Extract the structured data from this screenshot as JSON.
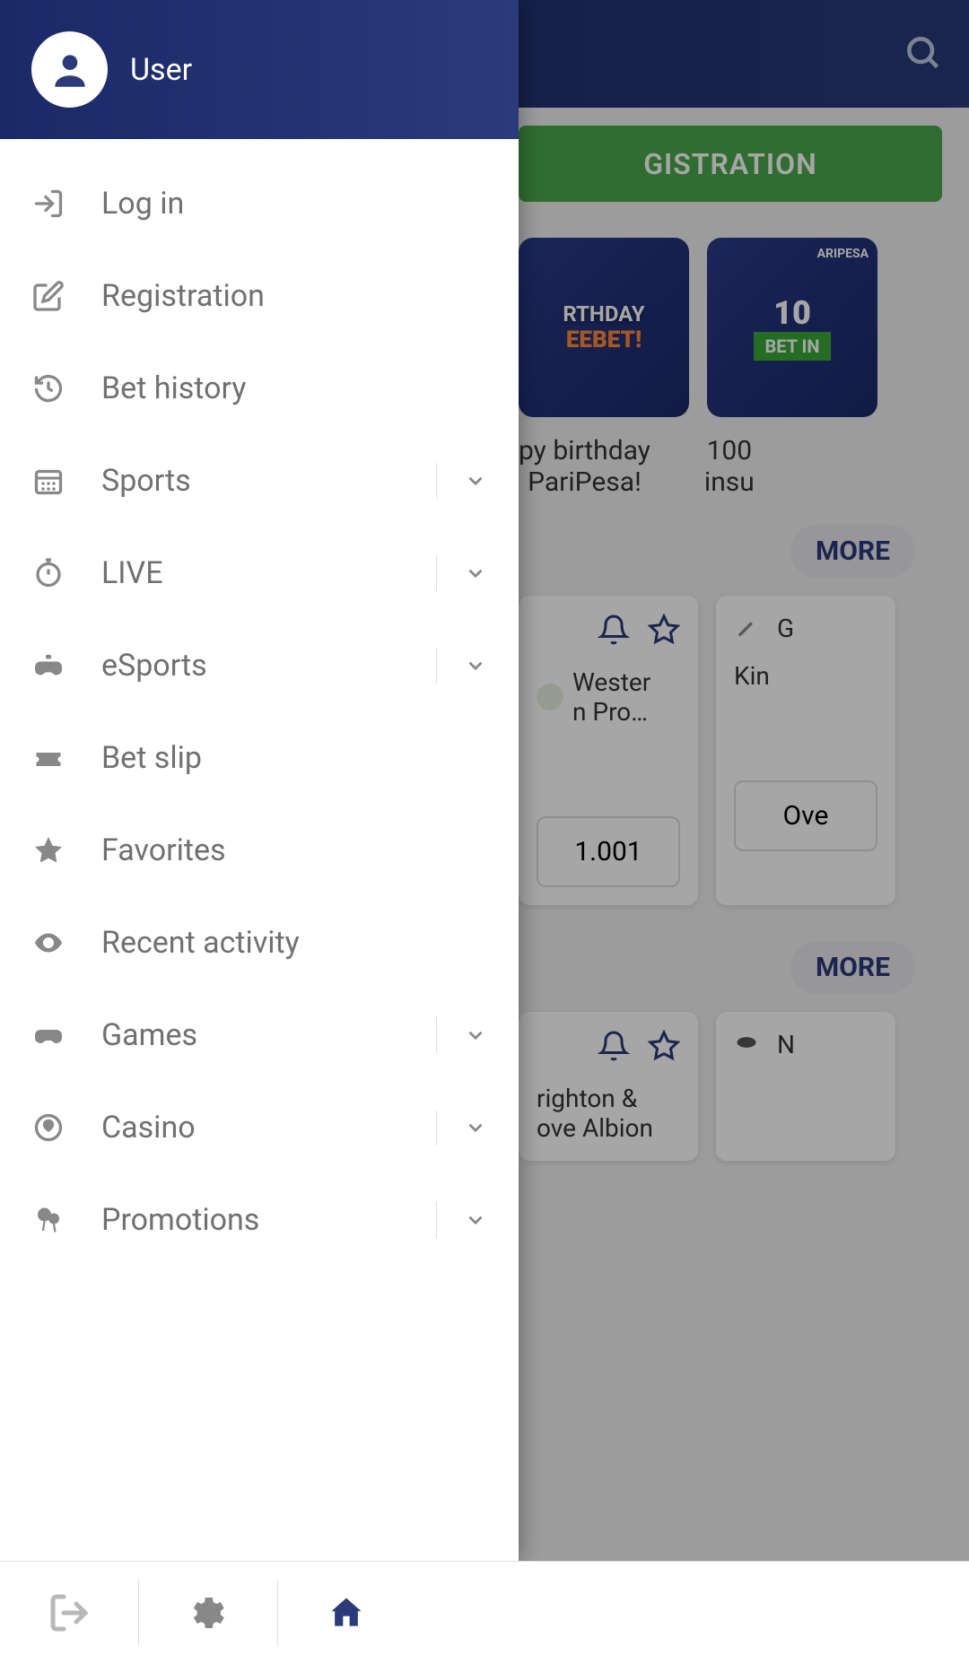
{
  "header": {
    "user_label": "User"
  },
  "drawer": {
    "items": [
      {
        "icon": "login-icon",
        "label": "Log in",
        "expandable": false
      },
      {
        "icon": "edit-icon",
        "label": "Registration",
        "expandable": false
      },
      {
        "icon": "history-icon",
        "label": "Bet history",
        "expandable": false
      },
      {
        "icon": "calendar-icon",
        "label": "Sports",
        "expandable": true
      },
      {
        "icon": "stopwatch-icon",
        "label": "LIVE",
        "expandable": true
      },
      {
        "icon": "gamepad-icon",
        "label": "eSports",
        "expandable": true
      },
      {
        "icon": "ticket-icon",
        "label": "Bet slip",
        "expandable": false
      },
      {
        "icon": "star-icon",
        "label": "Favorites",
        "expandable": false
      },
      {
        "icon": "eye-icon",
        "label": "Recent activity",
        "expandable": false
      },
      {
        "icon": "gamepad2-icon",
        "label": "Games",
        "expandable": true
      },
      {
        "icon": "casino-icon",
        "label": "Casino",
        "expandable": true
      },
      {
        "icon": "balloons-icon",
        "label": "Promotions",
        "expandable": true
      }
    ]
  },
  "background": {
    "registration_btn": "GISTRATION",
    "promo1_line1": "RTHDAY",
    "promo1_line2": "EEBET!",
    "promo2_brand": "ARIPESA",
    "promo2_line1": "10",
    "promo2_line2": "BET IN",
    "promo1_text": "py birthday\nPariPesa!",
    "promo2_text": "100\ninsu",
    "more_btn": "MORE",
    "team1": "Wester\nn Pro…",
    "team2": "Kin",
    "team2b": "G",
    "odd1": "1.001",
    "odd2": "Ove",
    "team3": "righton &\nove Albion",
    "team4_icon": "N"
  },
  "colors": {
    "primary": "#2a3a7a",
    "drawer_text": "#707070",
    "accent_green": "#4aa84a"
  }
}
